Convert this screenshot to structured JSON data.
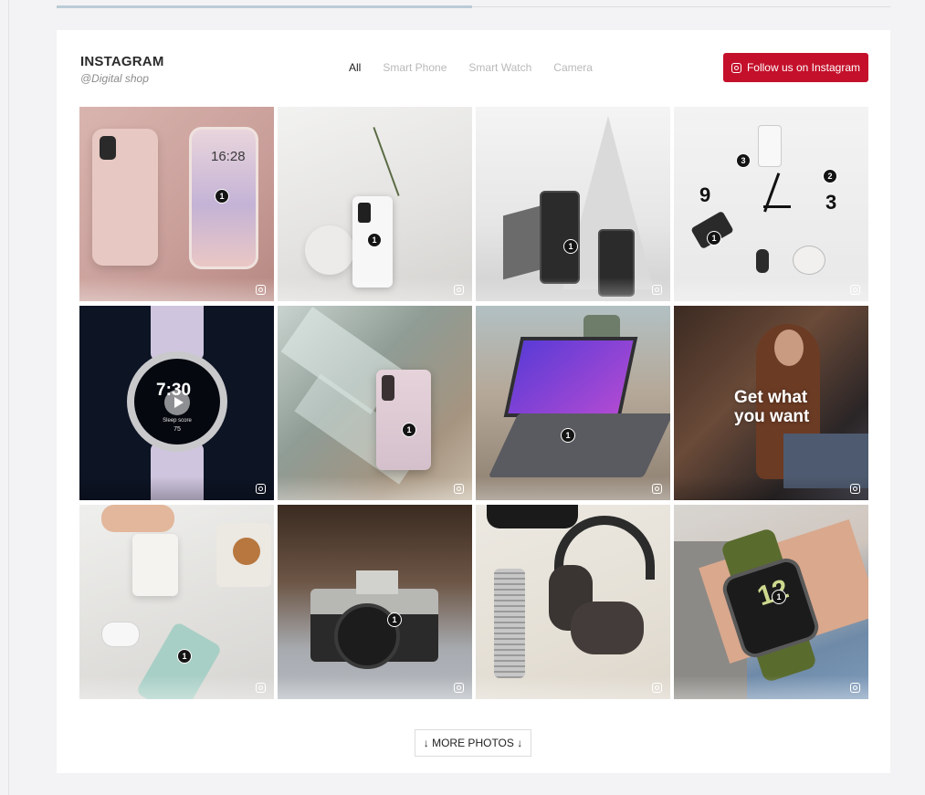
{
  "header": {
    "title": "INSTAGRAM",
    "subtitle": "@Digital shop",
    "follow_label": "Follow us on Instagram"
  },
  "filters": [
    {
      "label": "All",
      "active": true
    },
    {
      "label": "Smart Phone",
      "active": false
    },
    {
      "label": "Smart Watch",
      "active": false
    },
    {
      "label": "Camera",
      "active": false
    }
  ],
  "tiles": [
    {
      "subject": "pink smartphone",
      "hotspots": [
        "1"
      ],
      "screen_time": "16:28"
    },
    {
      "subject": "white smartphone with plant",
      "hotspots": [
        "1"
      ]
    },
    {
      "subject": "dark smartphones on pyramid",
      "hotspots": [
        "1"
      ]
    },
    {
      "subject": "products arranged as clock",
      "hotspots": [
        "1",
        "2",
        "3"
      ],
      "clock_numbers": [
        "9",
        "3"
      ]
    },
    {
      "subject": "smart watch video",
      "video": true,
      "watch_time": "7:30",
      "watch_detail": "Sleep score",
      "watch_score": "75"
    },
    {
      "subject": "pink phone on glass blocks",
      "hotspots": [
        "1"
      ]
    },
    {
      "subject": "laptop on table",
      "hotspots": [
        "1"
      ]
    },
    {
      "subject": "woman on sofa video",
      "video": true,
      "overlay_text": "Get what you want"
    },
    {
      "subject": "milk cookies and green phone",
      "hotspots": [
        "1"
      ]
    },
    {
      "subject": "retro camera",
      "hotspots": [
        "1"
      ]
    },
    {
      "subject": "headphones and accessories",
      "hotspots": []
    },
    {
      "subject": "smart watch on wrist",
      "hotspots": [
        "1"
      ],
      "watch_number": "12"
    }
  ],
  "more_button": {
    "label": "↓ MORE PHOTOS ↓"
  },
  "colors": {
    "accent": "#c4102b",
    "background": "#f3f2f4",
    "card": "#ffffff"
  }
}
